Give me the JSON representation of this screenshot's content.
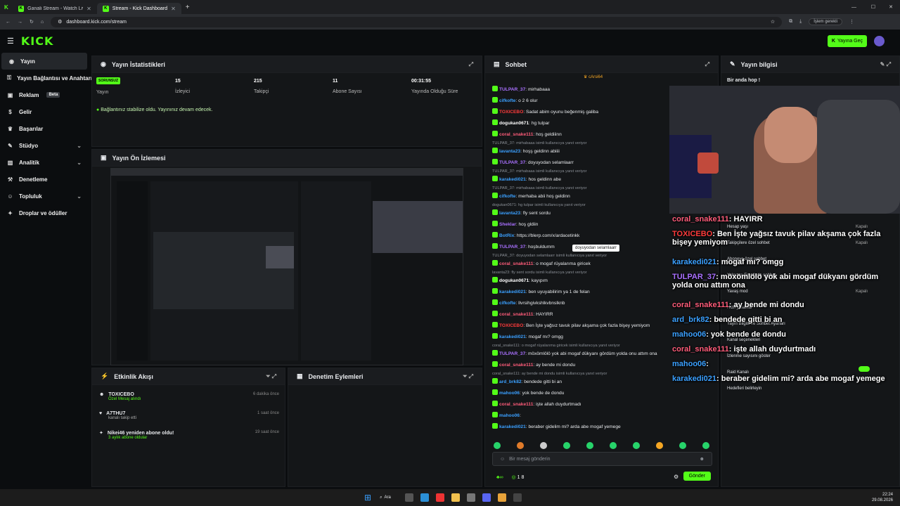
{
  "browser": {
    "tabs": [
      {
        "label": "Ganali Stream - Watch Live on Kick"
      },
      {
        "label": "Stream - Kick Dashboard"
      }
    ],
    "url": "dashboard.kick.com/stream",
    "profile_button": "İşlem gerekli"
  },
  "topnav": {
    "logo": "KICK",
    "go_live": "Yayına Geç"
  },
  "sidebar": {
    "items": [
      {
        "label": "Yayın"
      },
      {
        "label": "Yayın Bağlantısı ve Anahtarı"
      },
      {
        "label": "Reklam",
        "badge": "Beta"
      },
      {
        "label": "Gelir"
      },
      {
        "label": "Başarılar"
      },
      {
        "label": "Stüdyo"
      },
      {
        "label": "Analitik"
      },
      {
        "label": "Denetleme"
      },
      {
        "label": "Topluluk"
      },
      {
        "label": "Droplar ve ödüller"
      }
    ]
  },
  "stats": {
    "title": "Yayın İstatistikleri",
    "status_badge": "SORUNSUZ",
    "status_label": "Yayın",
    "items": [
      {
        "value": "15",
        "label": "İzleyici"
      },
      {
        "value": "215",
        "label": "Takipçi"
      },
      {
        "value": "11",
        "label": "Abone Sayısı"
      },
      {
        "value": "00:31:55",
        "label": "Yayında Olduğu Süre"
      }
    ],
    "notice": "Bağlantınız stabilize oldu. Yayınınız devam edecek."
  },
  "preview": {
    "title": "Yayın Ön İzlemesi"
  },
  "activity": {
    "title": "Etkinlik Akışı",
    "rows": [
      {
        "name": "TOXICEBO",
        "sub": "Özel Mesaj alındı",
        "time": "6 dakika önce"
      },
      {
        "name": "A7THU7",
        "sub": "kanalı takip etti",
        "time": "1 saat önce"
      },
      {
        "name": "Nikei46 yeniden abone oldu!",
        "sub": "3 aylık abone oldular",
        "time": "19 saat önce"
      }
    ]
  },
  "moderation": {
    "title": "Denetim Eylemleri"
  },
  "chat": {
    "title": "Sohbet",
    "pinned": "cArsi64",
    "messages": [
      {
        "user": "TULPAR_37",
        "text": "mirhabaaa",
        "color": "#a970ff"
      },
      {
        "user": "cifkofte",
        "text": "o 2 6 olur",
        "color": "#3ba0ff"
      },
      {
        "user": "TOXICEBO",
        "text": "Sadat abim oyunu beğenmiş galiba",
        "color": "#ff3b3b"
      },
      {
        "user": "dogukan0671",
        "text": "hg tulpar",
        "color": "#ffffff"
      },
      {
        "user": "coral_snake111",
        "text": "hoş geldiiinn",
        "color": "#ff5c7a"
      },
      {
        "sys": "TULPAR_37: mirhabaaa isimli kullanıcıya yanıt veriyor"
      },
      {
        "user": "lavanta23",
        "text": "hoşş geldinn abiiii",
        "color": "#3ba0ff"
      },
      {
        "user": "TULPAR_37",
        "text": "doyuyodan selamlaarr",
        "color": "#a970ff"
      },
      {
        "sys": "TULPAR_37: mirhabaaa isimli kullanıcıya yanıt veriyor"
      },
      {
        "user": "karakedi021",
        "text": "hos geldinn abe",
        "color": "#3ba0ff"
      },
      {
        "sys": "TULPAR_37: mirhabaaa isimli kullanıcıya yanıt veriyor"
      },
      {
        "user": "cifkofte",
        "text": "merhaba abii hoş geldinn",
        "color": "#3ba0ff"
      },
      {
        "sys": "dogukan0671: hg tulpar isimli kullanıcıya yanıt veriyor"
      },
      {
        "user": "lavanta23",
        "text": "fly sent sordu",
        "color": "#3ba0ff"
      },
      {
        "user": "Sheklar",
        "text": "hoş gldiin",
        "color": "#a970ff"
      },
      {
        "user": "BotRix",
        "text": "https://blerp.com/x/ardacetinkk",
        "color": "#3ba0ff"
      },
      {
        "user": "TULPAR_37",
        "text": "hoşbuldumm",
        "color": "#a970ff"
      },
      {
        "sys": "TULPAR_37: doyuyodan selamlaarr isimli kullanıcıya yanıt veriyor"
      },
      {
        "user": "coral_snake111",
        "text": "o mogaf rüyalarıma giricek",
        "color": "#ff5c7a"
      },
      {
        "sys": "lavanta23: fly sent sordu isimli kullanıcıya yanıt veriyor"
      },
      {
        "user": "dogukan0671",
        "text": "kayıpım",
        "color": "#ffffff"
      },
      {
        "user": "karakedi021",
        "text": "ben uyuyabilirim ya 1 de felan",
        "color": "#3ba0ff"
      },
      {
        "user": "cifkofte",
        "text": "llvrsihgivkshlkvbnslknb",
        "color": "#3ba0ff"
      },
      {
        "user": "coral_snake111",
        "text": "HAYIRR",
        "color": "#ff5c7a"
      },
      {
        "user": "TOXICEBO",
        "text": "Ben İşte yağsız tavuk pilav akşama çok fazla bişey yemiyom",
        "color": "#ff3b3b"
      },
      {
        "user": "karakedi021",
        "text": "mogaf mı? omgg",
        "color": "#3ba0ff"
      },
      {
        "sys": "coral_snake111: o mogaf rüyalarıma giricek isimli kullanıcıya yanıt veriyor"
      },
      {
        "user": "TULPAR_37",
        "text": "möxömlölö yok abi mogaf dükyanı gördüm yolda onu attım ona",
        "color": "#a970ff"
      },
      {
        "user": "coral_snake111",
        "text": "ay bende mi dondu",
        "color": "#ff5c7a"
      },
      {
        "sys": "coral_snake111: ay bende mi dondu isimli kullanıcıya yanıt veriyor"
      },
      {
        "user": "ard_brk82",
        "text": "bendede gitti bi an",
        "color": "#3ba0ff"
      },
      {
        "user": "mahoo06",
        "text": "yok bende de dondu",
        "color": "#3ba0ff"
      },
      {
        "user": "coral_snake111",
        "text": "işte allah duydurtmadı",
        "color": "#ff5c7a"
      },
      {
        "user": "mahoo06",
        "text": "",
        "color": "#3ba0ff"
      },
      {
        "user": "karakedi021",
        "text": "beraber gidelim mi? arda abe mogaf yemege",
        "color": "#3ba0ff"
      }
    ],
    "tooltip": "doyuyodan selamlaarr",
    "input_placeholder": "Bir mesaj gönderin",
    "points": "1 8",
    "send_label": "Gönder"
  },
  "info": {
    "title": "Yayın bilgisi",
    "stream_title": "Bir anda hop !",
    "settings": [
      {
        "label": "Hesap yaşı",
        "value": "Kapalı"
      },
      {
        "label": "Takipçilere özel sohbet",
        "value": "Kapalı"
      },
      {
        "label": "Aboneye özel sohbet",
        "value": ""
      },
      {
        "label": "Yalnızca Emotlarla sohbet",
        "value": ""
      },
      {
        "label": "Yavaş mod",
        "value": "Kapalı"
      },
      {
        "label": "Hızlı yasaklar",
        "value": ""
      },
      {
        "label": "Yayın Bilgisi ve Sohbet Ayarları",
        "value": ""
      },
      {
        "label": "Kanal seçenekleri",
        "value": ""
      },
      {
        "label": "İzlenme sayısını göster",
        "value": ""
      },
      {
        "label": "Raid Kanalı",
        "value": ""
      },
      {
        "label": "Hedefleri belirleyin",
        "value": ""
      }
    ]
  },
  "overlay_chat": [
    {
      "user": "coral_snake111",
      "text": ": HAYIRR",
      "color": "#ff5c7a"
    },
    {
      "user": "TOXICEBO",
      "text": ": Ben İşte yağsız tavuk pilav akşama çok fazla bişey yemiyom",
      "color": "#ff3b3b"
    },
    {
      "user": "karakedi021",
      "text": ": mogaf mı? omgg",
      "color": "#3ba0ff"
    },
    {
      "user": "TULPAR_37",
      "text": ": möxömlölö yok abi mogaf dükyanı gördüm yolda onu attım ona",
      "color": "#a970ff"
    },
    {
      "user": "coral_snake111",
      "text": ": ay bende mi dondu",
      "color": "#ff5c7a"
    },
    {
      "user": "ard_brk82",
      "text": ": bendede gitti bi an",
      "color": "#3ba0ff"
    },
    {
      "user": "mahoo06",
      "text": ": yok bende de dondu",
      "color": "#3ba0ff"
    },
    {
      "user": "coral_snake111",
      "text": ": işte allah duydurtmadı",
      "color": "#ff5c7a"
    },
    {
      "user": "mahoo06",
      "text": ":",
      "color": "#3ba0ff"
    },
    {
      "user": "karakedi021",
      "text": ": beraber gidelim mi? arda abe mogaf yemege",
      "color": "#3ba0ff"
    }
  ],
  "taskbar": {
    "search": "Ara",
    "time": "22:24",
    "date": "29.08.2026"
  },
  "colors": {
    "accent": "#53fc18",
    "bg": "#0b0d0f",
    "panel": "#141618"
  }
}
